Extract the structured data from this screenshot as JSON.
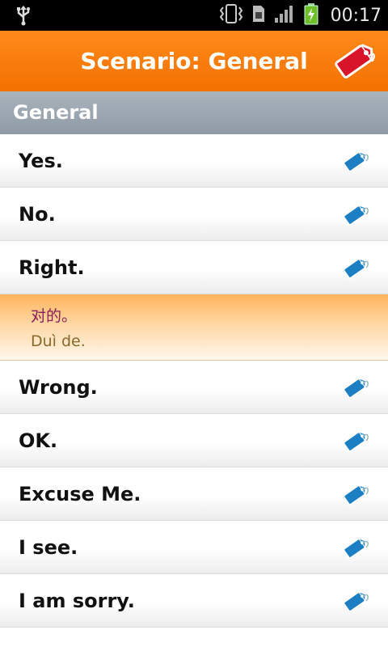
{
  "status_bar": {
    "time": "00:17",
    "icons": [
      "usb-icon",
      "vibrate-icon",
      "sim-icon",
      "signal-icon",
      "battery-charging-icon"
    ]
  },
  "header": {
    "title": "Scenario: General",
    "tag_icon": "tag-icon"
  },
  "section": {
    "label": "General"
  },
  "phrases": [
    {
      "label": "Yes."
    },
    {
      "label": "No."
    },
    {
      "label": "Right.",
      "expanded": true,
      "chinese": "对的。",
      "pinyin": "Duì de."
    },
    {
      "label": "Wrong."
    },
    {
      "label": "OK."
    },
    {
      "label": "Excuse Me."
    },
    {
      "label": "I see."
    },
    {
      "label": "I am sorry."
    }
  ],
  "colors": {
    "accent": "#f37100",
    "section": "#9aa5af",
    "tag_blue": "#1c7fc4",
    "tag_red": "#d8142a"
  }
}
